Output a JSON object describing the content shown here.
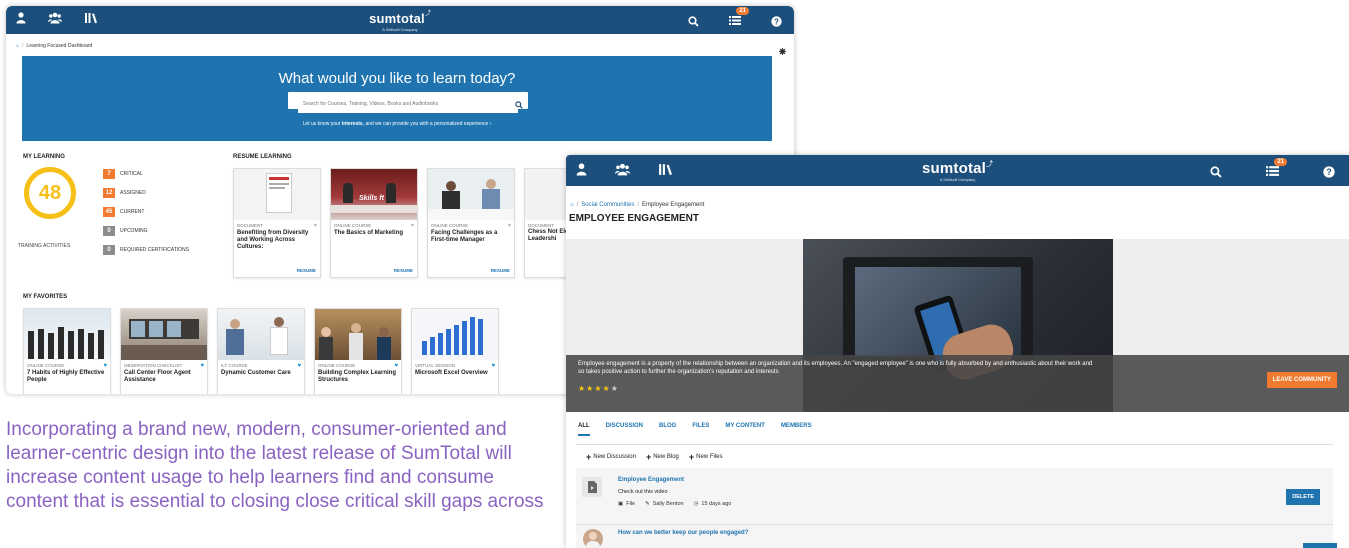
{
  "colors": {
    "nav_bg": "#1d4f7c",
    "hero_bg": "#1f74b0",
    "accent_orange": "#f07a2f",
    "ring_yellow": "#f6c018",
    "link_blue": "#1f74b0",
    "caption_purple": "#8a63c2"
  },
  "app": {
    "logo": "sumtotal",
    "logo_sub": "A Skillsoft Company",
    "notifications": "21"
  },
  "dashboard": {
    "breadcrumb": "Learning Focused Dashboard",
    "hero_question": "What would you like to learn today?",
    "search_placeholder": "Search for Courses, Training, Videos, Books and Audiobooks",
    "hint_pre": "Let us know your ",
    "hint_bold": "interests",
    "hint_post": ", and we can provide you with a personalized experience ›",
    "my_learning_title": "MY LEARNING",
    "training_total": "48",
    "training_label": "TRAINING ACTIVITIES",
    "stats": [
      {
        "count": "7",
        "label": "CRITICAL",
        "color": "#f07a2f"
      },
      {
        "count": "12",
        "label": "ASSIGNED",
        "color": "#f07a2f"
      },
      {
        "count": "45",
        "label": "CURRENT",
        "color": "#f07a2f"
      },
      {
        "count": "0",
        "label": "UPCOMING",
        "color": "#8c8c8c"
      },
      {
        "count": "0",
        "label": "REQUIRED CERTIFICATIONS",
        "color": "#8c8c8c"
      }
    ],
    "resume_title": "RESUME LEARNING",
    "resume_cards": [
      {
        "type": "DOCUMENT",
        "title": "Benefiting from Diversity and Working Across Cultures:",
        "action": "RESUME"
      },
      {
        "type": "ONLINE COURSE",
        "title": "The Basics of Marketing",
        "action": "RESUME",
        "thumb_text": "Skills ft"
      },
      {
        "type": "ONLINE COURSE",
        "title": "Facing Challenges as a First-time Manager",
        "action": "RESUME"
      },
      {
        "type": "DOCUMENT",
        "title": "Chess Not Elevate Yo Leadershi"
      }
    ],
    "favorites_title": "MY FAVORITES",
    "favorite_cards": [
      {
        "type": "ONLINE COURSE",
        "title": "7 Habits of Highly Effective People"
      },
      {
        "type": "OBSERVATION CHECKLIST",
        "title": "Call Center Floor Agent Assistance"
      },
      {
        "type": "ILT COURSE",
        "title": "Dynamic Customer Care"
      },
      {
        "type": "ONLINE COURSE",
        "title": "Building Complex Learning Structures"
      },
      {
        "type": "VIRTUAL SESSION",
        "title": "Microsoft Excel Overview"
      }
    ]
  },
  "caption": "Incorporating a brand new, modern, consumer-oriented and learner-centric design into the latest release of SumTotal will increase content usage to help learners find and consume content that is essential to closing close critical skill gaps across",
  "community": {
    "breadcrumb_link": "Social Communities",
    "breadcrumb_current": "Employee Engagement",
    "title": "EMPLOYEE ENGAGEMENT",
    "description": "Employee engagement is a property of the relationship between an organization and its employees. An \"engaged employee\" is one who is fully absorbed by and enthusiastic about their work and so takes positive action to further the organization's reputation and interests",
    "rating": 4,
    "leave_label": "LEAVE COMMUNITY",
    "tabs": [
      "ALL",
      "DISCUSSION",
      "BLOG",
      "FILES",
      "MY CONTENT",
      "MEMBERS"
    ],
    "new_actions": [
      "New Discussion",
      "New Blog",
      "New Files"
    ],
    "feed": [
      {
        "title": "Employee Engagement",
        "text": "Check out this video",
        "kind": "File",
        "author": "Sally Benton",
        "time": "15 days ago",
        "action": "DELETE"
      },
      {
        "title": "How can we better keep our people engaged?"
      }
    ]
  }
}
